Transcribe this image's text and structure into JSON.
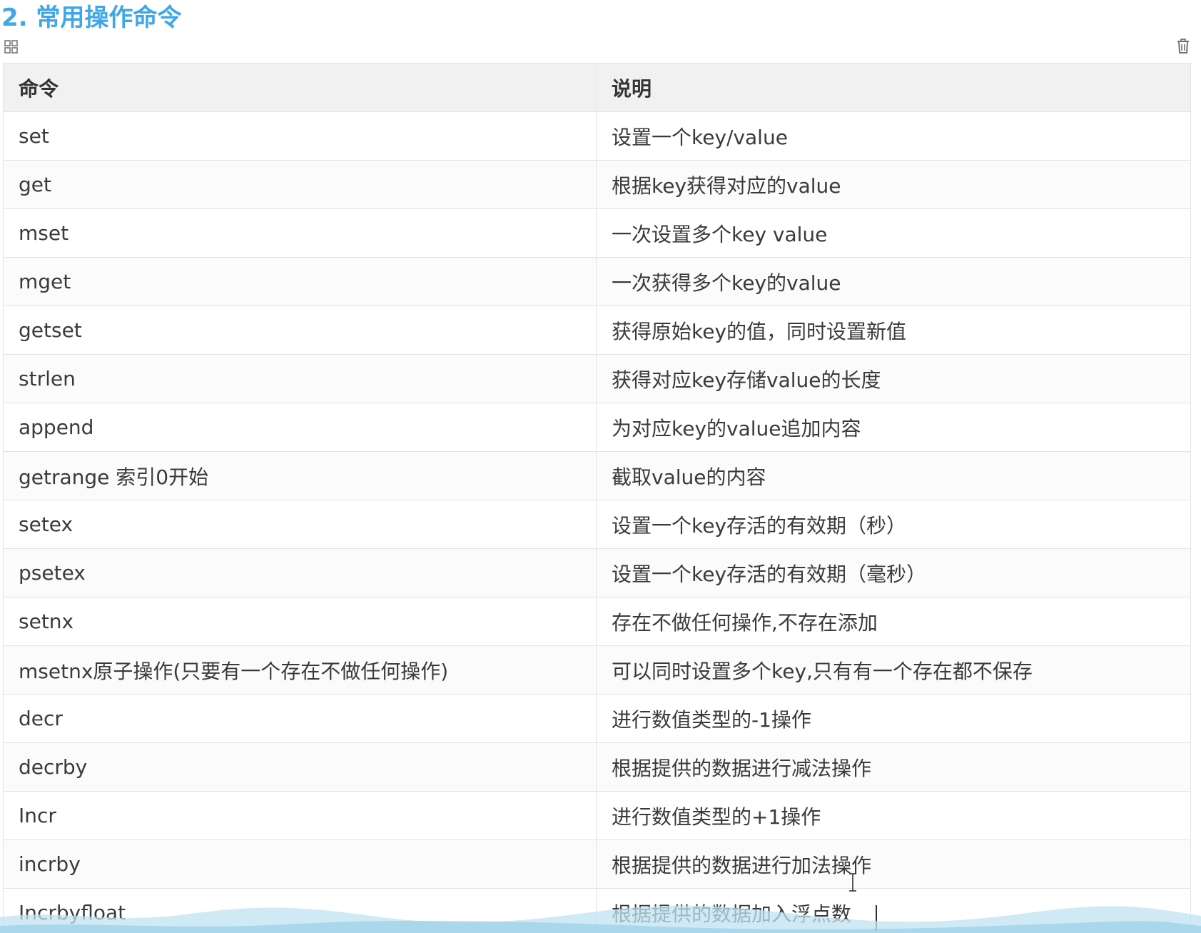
{
  "heading": "2. 常用操作命令",
  "icons": {
    "grid": "grid-view-icon",
    "trash": "trash-icon"
  },
  "colors": {
    "heading": "#3ea7e8",
    "header_bg": "#f1f1f1",
    "border": "#e3e3e3",
    "bottom_band": "#bfe2f2"
  },
  "table": {
    "headers": [
      "命令",
      "说明"
    ],
    "rows": [
      [
        "set",
        "设置一个key/value"
      ],
      [
        "get",
        "根据key获得对应的value"
      ],
      [
        "mset",
        "一次设置多个key value"
      ],
      [
        "mget",
        "一次获得多个key的value"
      ],
      [
        "getset",
        "获得原始key的值，同时设置新值"
      ],
      [
        "strlen",
        "获得对应key存储value的长度"
      ],
      [
        "append",
        "为对应key的value追加内容"
      ],
      [
        "getrange 索引0开始",
        "截取value的内容"
      ],
      [
        "setex",
        "设置一个key存活的有效期（秒）"
      ],
      [
        "psetex",
        "设置一个key存活的有效期（毫秒）"
      ],
      [
        "setnx",
        "存在不做任何操作,不存在添加"
      ],
      [
        "msetnx原子操作(只要有一个存在不做任何操作)",
        "可以同时设置多个key,只有有一个存在都不保存"
      ],
      [
        "decr",
        "进行数值类型的-1操作"
      ],
      [
        "decrby",
        "根据提供的数据进行减法操作"
      ],
      [
        "Incr",
        "进行数值类型的+1操作"
      ],
      [
        "incrby",
        "根据提供的数据进行加法操作"
      ],
      [
        "Incrbyfloat",
        "根据提供的数据加入浮点数"
      ]
    ]
  }
}
